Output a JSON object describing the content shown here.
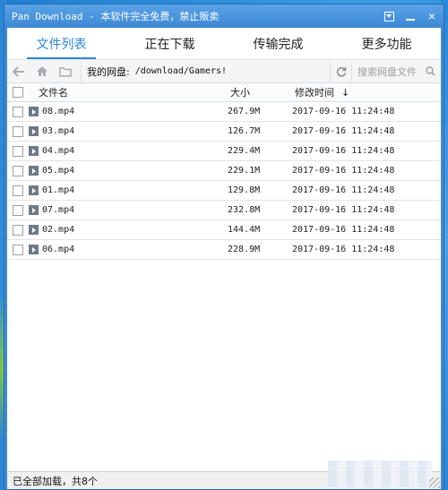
{
  "window": {
    "title": "Pan Download - 本软件完全免费，禁止贩卖"
  },
  "tabs": [
    {
      "label": "文件列表",
      "active": true
    },
    {
      "label": "正在下载",
      "active": false
    },
    {
      "label": "传输完成",
      "active": false
    },
    {
      "label": "更多功能",
      "active": false
    }
  ],
  "toolbar": {
    "path_label": "我的网盘:",
    "path_value": "/download/Gamers!",
    "search_placeholder": "搜索网盘文件"
  },
  "table": {
    "columns": {
      "name": "文件名",
      "size": "大小",
      "time": "修改时间"
    },
    "sort_indicator": "↓",
    "rows": [
      {
        "name": "08.mp4",
        "size": "267.9M",
        "time": "2017-09-16 11:24:48"
      },
      {
        "name": "03.mp4",
        "size": "126.7M",
        "time": "2017-09-16 11:24:48"
      },
      {
        "name": "04.mp4",
        "size": "229.4M",
        "time": "2017-09-16 11:24:48"
      },
      {
        "name": "05.mp4",
        "size": "229.1M",
        "time": "2017-09-16 11:24:48"
      },
      {
        "name": "01.mp4",
        "size": "129.8M",
        "time": "2017-09-16 11:24:48"
      },
      {
        "name": "07.mp4",
        "size": "232.8M",
        "time": "2017-09-16 11:24:48"
      },
      {
        "name": "02.mp4",
        "size": "144.4M",
        "time": "2017-09-16 11:24:48"
      },
      {
        "name": "06.mp4",
        "size": "228.9M",
        "time": "2017-09-16 11:24:48"
      }
    ]
  },
  "status": {
    "text": "已全部加载，共8个"
  },
  "colors": {
    "accent": "#2b86d8",
    "titlebar": "#3d88d4"
  }
}
